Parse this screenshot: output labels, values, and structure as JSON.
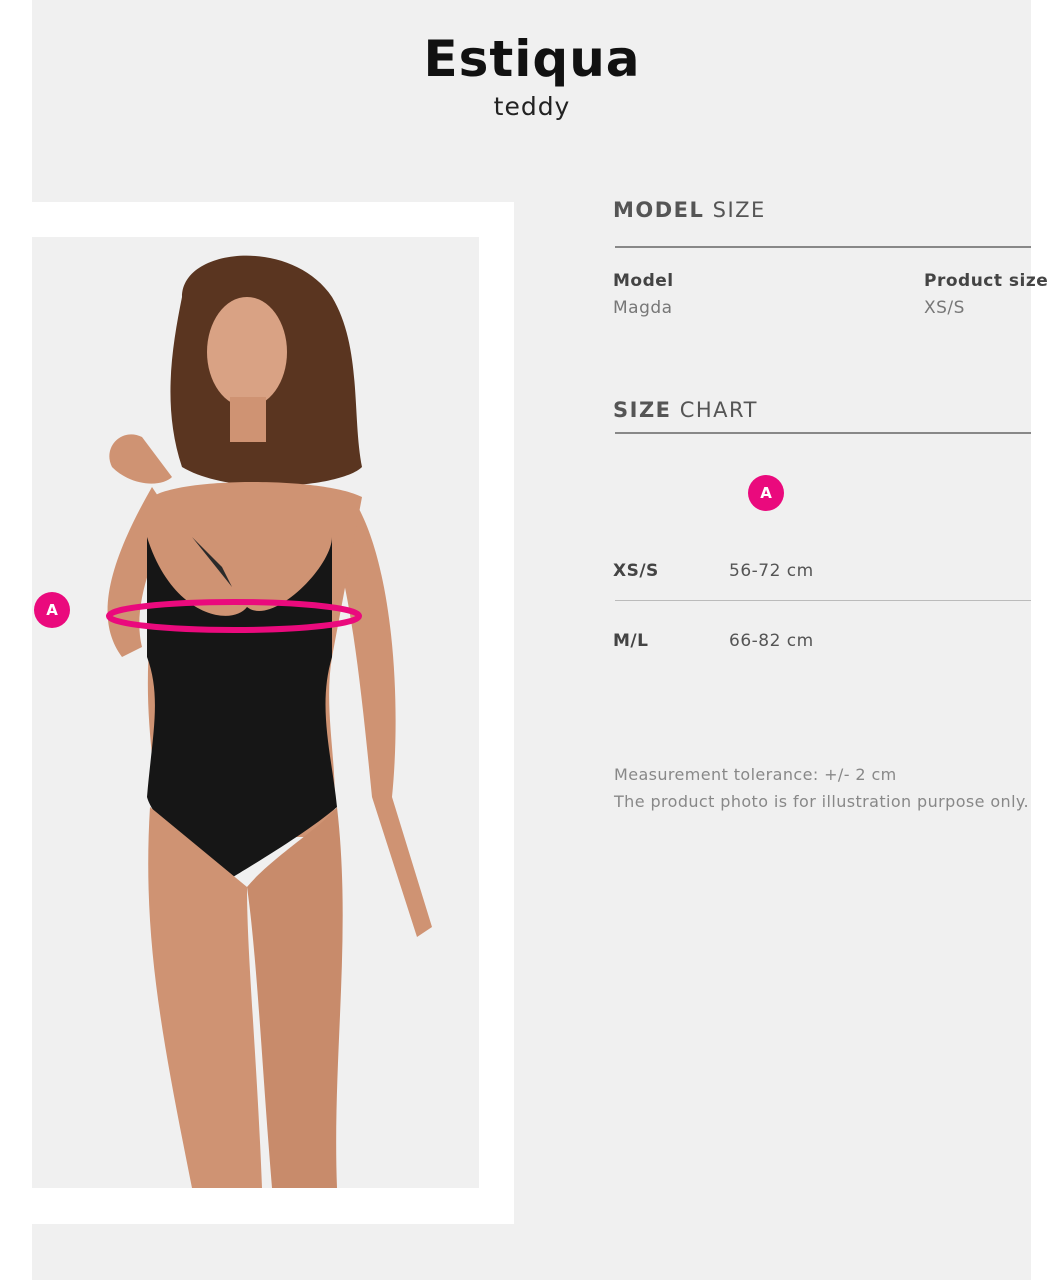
{
  "product": {
    "name": "Estiqua",
    "type": "teddy"
  },
  "model_size": {
    "heading_bold": "MODEL",
    "heading_light": "SIZE",
    "model_label": "Model",
    "model_value": "Magda",
    "size_label": "Product size",
    "size_value": "XS/S"
  },
  "size_chart": {
    "heading_bold": "SIZE",
    "heading_light": "CHART",
    "column_marker": "A",
    "rows": [
      {
        "size": "XS/S",
        "a": "56-72 cm"
      },
      {
        "size": "M/L",
        "a": "66-82 cm"
      }
    ]
  },
  "photo": {
    "marker": "A",
    "accent_color": "#ea0a7d"
  },
  "notes": {
    "tolerance": "Measurement tolerance: +/- 2 cm",
    "disclaimer": "The product photo is for illustration purpose only."
  }
}
